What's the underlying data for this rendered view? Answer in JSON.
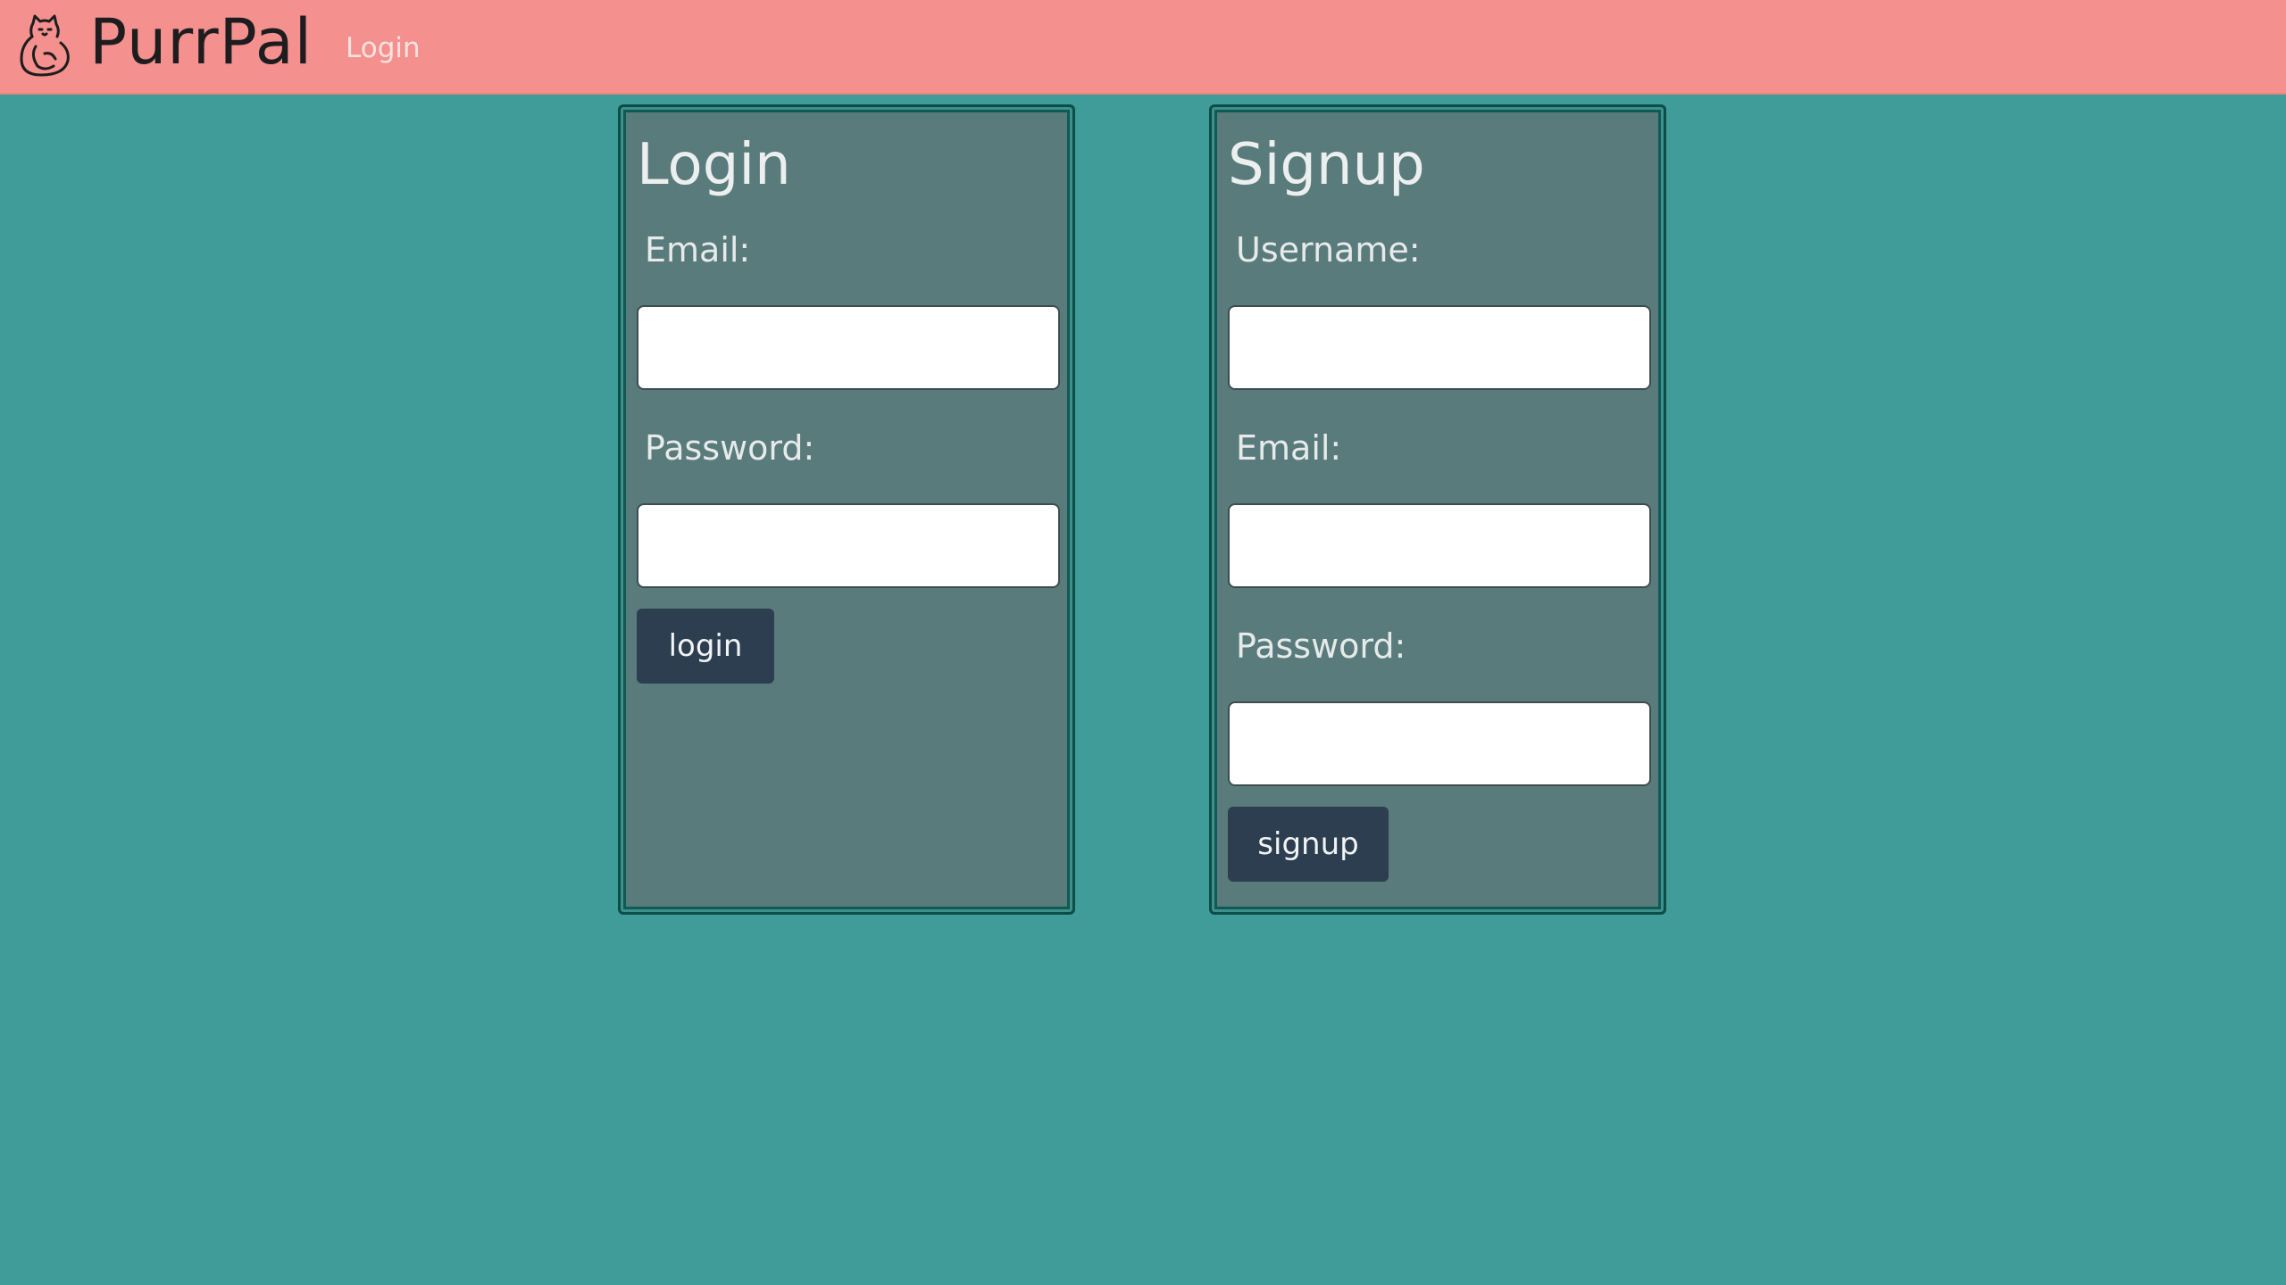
{
  "navbar": {
    "brand": "PurrPal",
    "links": [
      "Login"
    ],
    "logo_icon": "cat-icon"
  },
  "login": {
    "title": "Login",
    "email_label": "Email:",
    "email_value": "",
    "password_label": "Password:",
    "password_value": "",
    "button_label": "login"
  },
  "signup": {
    "title": "Signup",
    "username_label": "Username:",
    "username_value": "",
    "email_label": "Email:",
    "email_value": "",
    "password_label": "Password:",
    "password_value": "",
    "button_label": "signup"
  },
  "colors": {
    "navbar_bg": "#f4908e",
    "page_bg": "#409c99",
    "panel_bg": "#5a7b7b",
    "panel_border": "#0b4d48",
    "button_bg": "#2c3e50"
  }
}
